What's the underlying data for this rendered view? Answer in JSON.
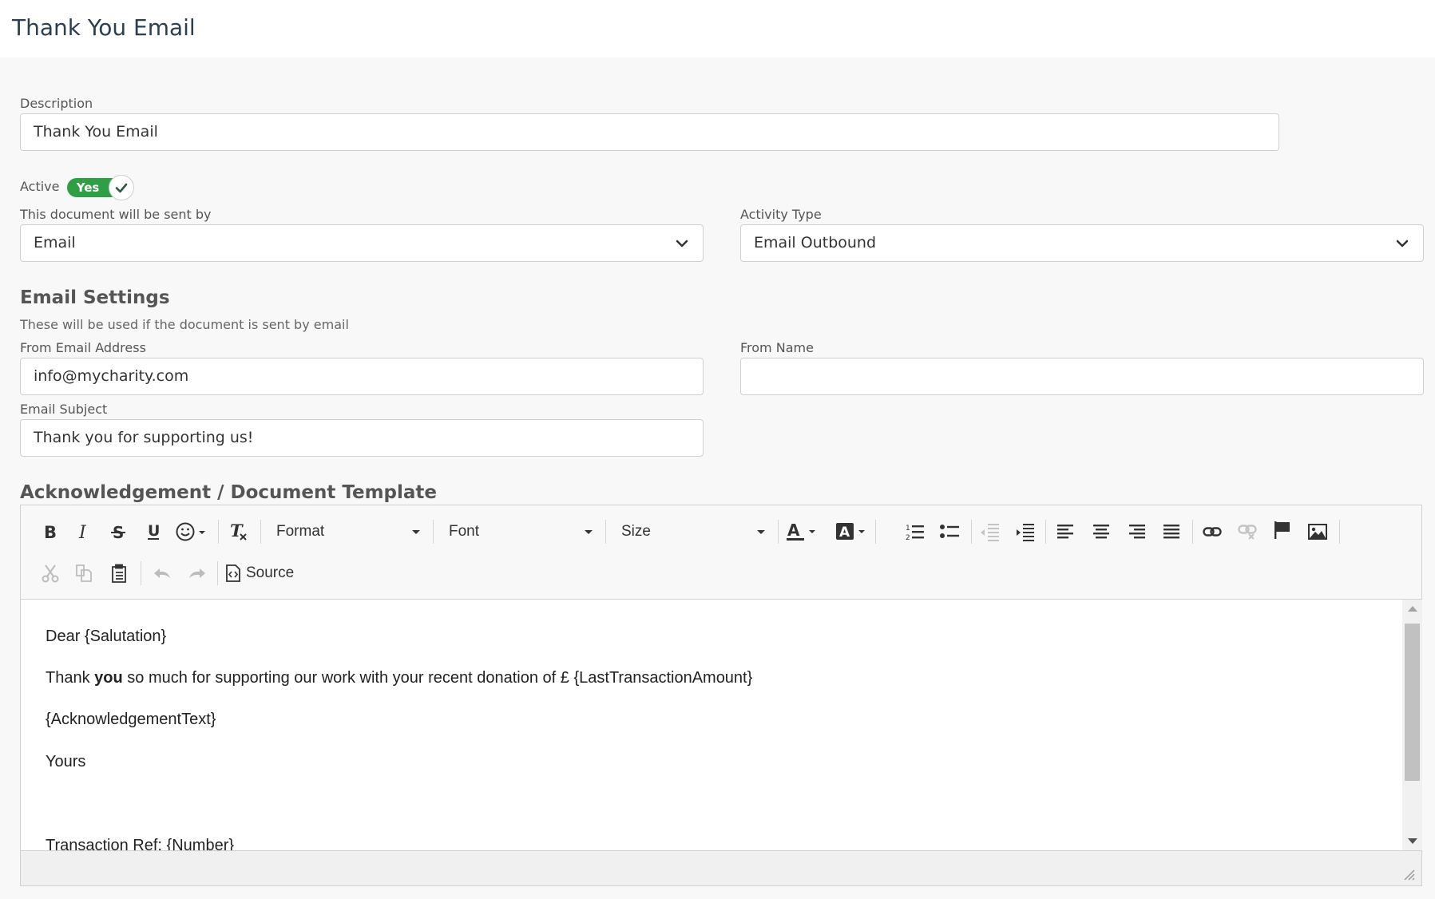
{
  "page": {
    "title": "Thank You Email"
  },
  "form": {
    "description": {
      "label": "Description",
      "value": "Thank You Email"
    },
    "active": {
      "label": "Active",
      "toggle_text": "Yes",
      "on": true,
      "color": "#2f9e44"
    },
    "sent_by": {
      "label": "This document will be sent by",
      "value": "Email"
    },
    "activity_type": {
      "label": "Activity Type",
      "value": "Email Outbound"
    }
  },
  "email_settings": {
    "heading": "Email Settings",
    "helper": "These will be used if the document is sent by email",
    "from_email": {
      "label": "From Email Address",
      "value": "info@mycharity.com"
    },
    "from_name": {
      "label": "From Name",
      "value": ""
    },
    "subject": {
      "label": "Email Subject",
      "value": "Thank you for supporting us!"
    }
  },
  "template": {
    "heading": "Acknowledgement / Document Template",
    "toolbar": {
      "row1_icons": [
        "bold-icon",
        "italic-icon",
        "strikethrough-icon",
        "underline-icon",
        "emoji-icon",
        "remove-format-icon",
        "text-color-icon",
        "background-color-icon",
        "numbered-list-icon",
        "bulleted-list-icon",
        "outdent-icon",
        "indent-icon",
        "align-left-icon",
        "align-center-icon",
        "align-right-icon",
        "justify-icon",
        "link-icon",
        "unlink-icon",
        "anchor-flag-icon",
        "image-icon"
      ],
      "format_label": "Format",
      "font_label": "Font",
      "size_label": "Size",
      "row2_icons": [
        "cut-icon",
        "copy-icon",
        "paste-icon",
        "undo-icon",
        "redo-icon",
        "source-icon"
      ],
      "source_label": "Source"
    },
    "body": {
      "line1": "Dear {Salutation}",
      "line2_before": "Thank ",
      "line2_bold": "you",
      "line2_after": " so much for supporting our work with your recent donation of £ {LastTransactionAmount}",
      "line3": "{AcknowledgementText}",
      "line4": "Yours",
      "line5": "Transaction Ref: {Number}"
    }
  }
}
